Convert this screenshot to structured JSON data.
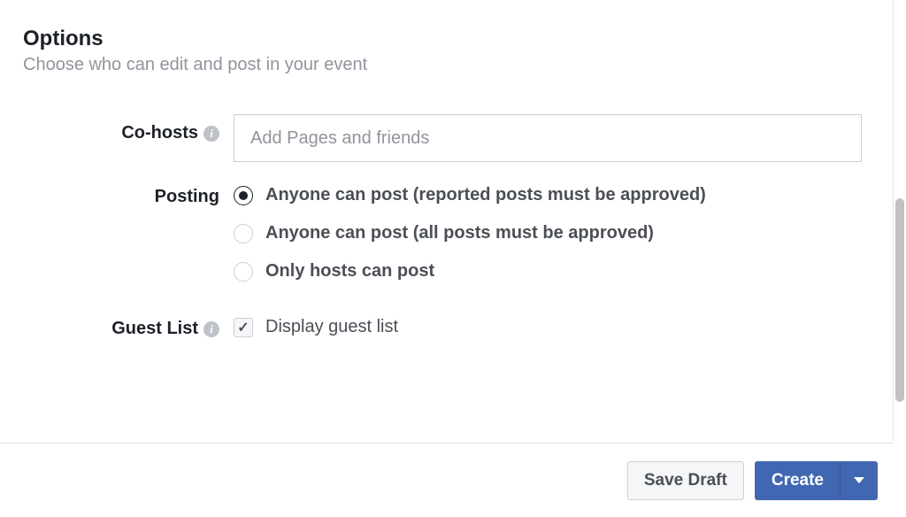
{
  "header": {
    "title": "Options",
    "subtitle": "Choose who can edit and post in your event"
  },
  "cohosts": {
    "label": "Co-hosts",
    "placeholder": "Add Pages and friends",
    "value": ""
  },
  "posting": {
    "label": "Posting",
    "options": [
      "Anyone can post (reported posts must be approved)",
      "Anyone can post (all posts must be approved)",
      "Only hosts can post"
    ],
    "selected": 0
  },
  "guestlist": {
    "label": "Guest List",
    "checkbox_label": "Display guest list",
    "checked": true
  },
  "footer": {
    "save_draft": "Save Draft",
    "create": "Create"
  }
}
